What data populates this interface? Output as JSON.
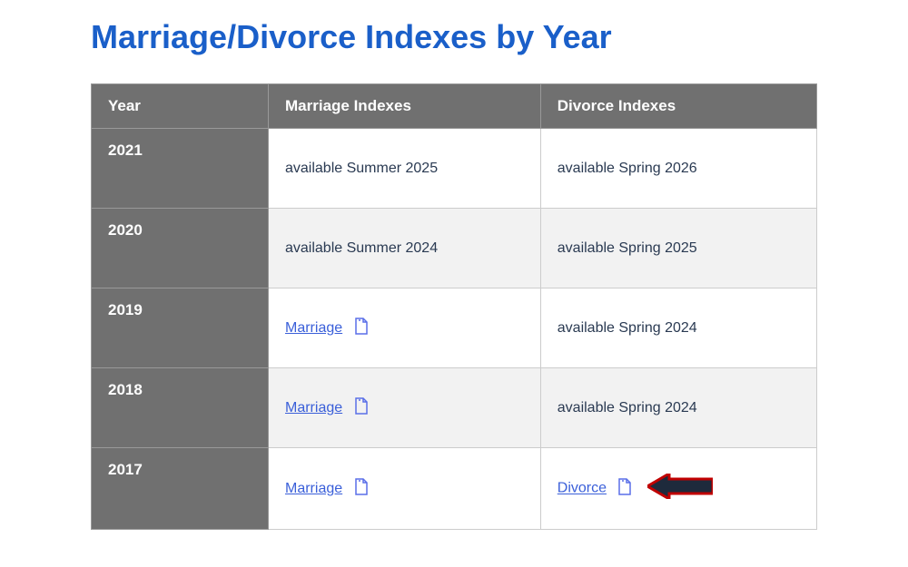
{
  "title": "Marriage/Divorce Indexes by Year",
  "table": {
    "headers": {
      "year": "Year",
      "marriage": "Marriage Indexes",
      "divorce": "Divorce Indexes"
    },
    "rows": [
      {
        "year": "2021",
        "marriage_type": "text",
        "marriage_text": "available Summer 2025",
        "divorce_type": "text",
        "divorce_text": "available Spring 2026"
      },
      {
        "year": "2020",
        "marriage_type": "text",
        "marriage_text": "available Summer 2024",
        "divorce_type": "text",
        "divorce_text": "available Spring 2025"
      },
      {
        "year": "2019",
        "marriage_type": "link",
        "marriage_text": "Marriage",
        "divorce_type": "text",
        "divorce_text": "available Spring 2024"
      },
      {
        "year": "2018",
        "marriage_type": "link",
        "marriage_text": "Marriage",
        "divorce_type": "text",
        "divorce_text": "available Spring 2024"
      },
      {
        "year": "2017",
        "marriage_type": "link",
        "marriage_text": "Marriage",
        "divorce_type": "link",
        "divorce_text": "Divorce",
        "has_arrow": true
      }
    ]
  }
}
